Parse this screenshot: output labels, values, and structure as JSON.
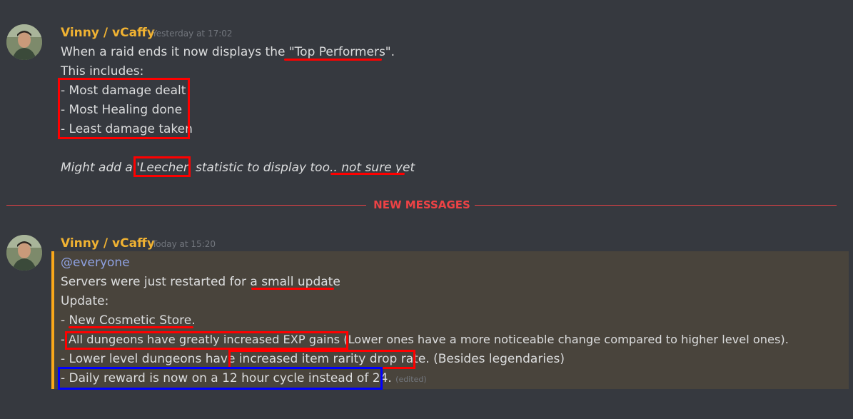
{
  "messages": [
    {
      "author": "Vinny / vCaffy",
      "timestamp": "Yesterday at 17:02",
      "lines": [
        "When a raid ends it now displays the \"Top Performers\".",
        "This includes:",
        "- Most damage dealt",
        "- Most Healing done",
        "- Least damage taken",
        "Might add a 'Leecher' statistic to display too.. not sure yet"
      ]
    },
    {
      "author": "Vinny / vCaffy",
      "timestamp": "Today at 15:20",
      "mention": "@everyone",
      "lines": [
        "Servers were just restarted for a small update",
        "Update:",
        "- New Cosmetic Store.",
        "- All dungeons have greatly increased EXP gains (Lower ones have a more noticeable change compared to higher level ones).",
        "- Lower level dungeons have increased item rarity drop rate. (Besides legendaries)",
        "- Daily reward is now on a 12 hour cycle instead of 24."
      ],
      "edited": "(edited)"
    }
  ],
  "divider": {
    "label": "NEW MESSAGES"
  },
  "colors": {
    "background": "#36393f",
    "author": "#f0b232",
    "divider": "#ed4245",
    "mention_highlight_bg": "#49443c",
    "mention_highlight_border": "#faa81a",
    "mention_text": "#8ea1e1",
    "annotation_red": "#ff0000",
    "annotation_blue": "#0000ff"
  },
  "icons": {
    "avatar": "user-avatar-photo"
  }
}
